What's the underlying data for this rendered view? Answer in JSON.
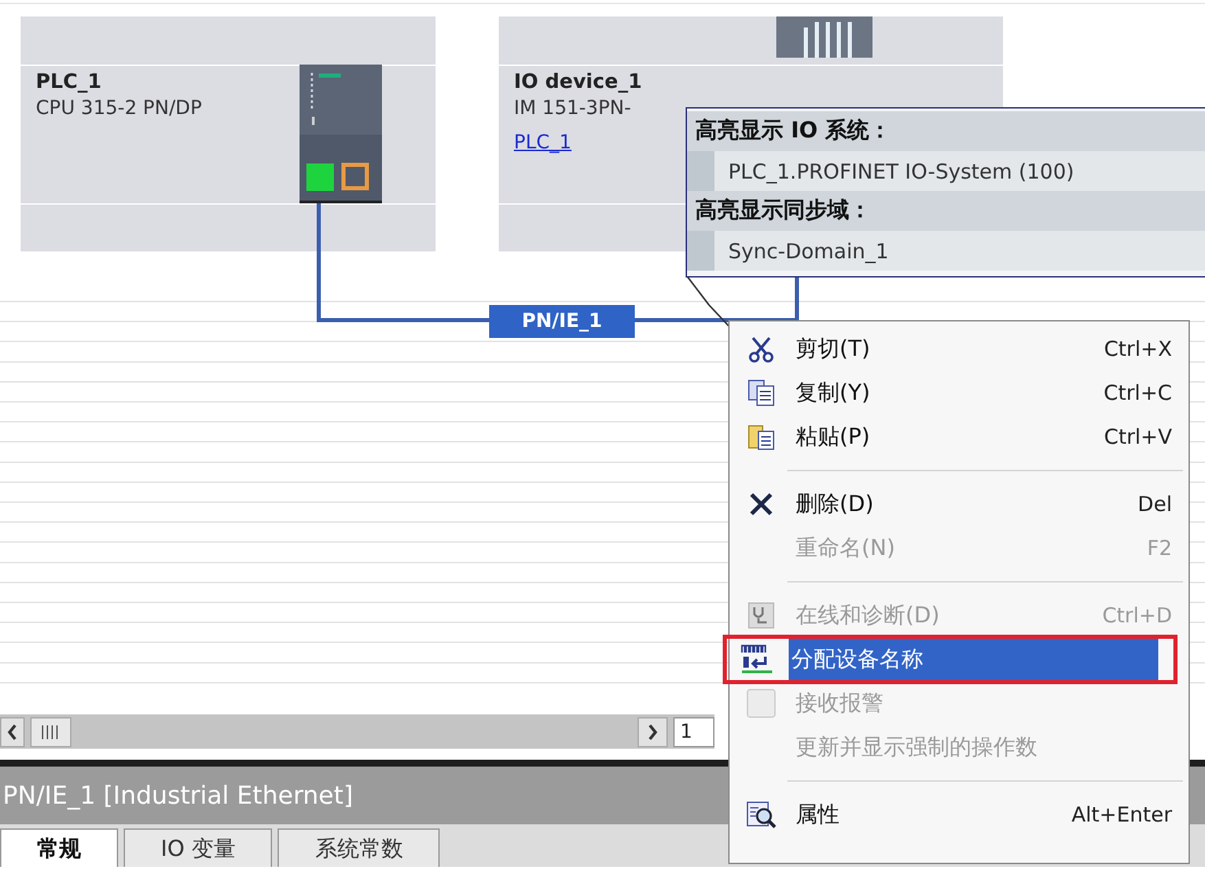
{
  "devices": [
    {
      "name": "PLC_1",
      "model": "CPU 315-2 PN/DP",
      "kind": "cpu"
    },
    {
      "name": "IO device_1",
      "model": "IM 151-3PN-",
      "link": "PLC_1",
      "kind": "io"
    }
  ],
  "network": {
    "label": "PN/IE_1"
  },
  "tooltip": {
    "sections": [
      {
        "heading": "高亮显示 IO 系统：",
        "item": "PLC_1.PROFINET IO-System (100)"
      },
      {
        "heading": "高亮显示同步域：",
        "item": "Sync-Domain_1"
      }
    ]
  },
  "context_menu": [
    {
      "kind": "item",
      "label": "剪切(T)",
      "shortcut": "Ctrl+X",
      "disabled": false,
      "selected": false,
      "outlined": false
    },
    {
      "kind": "item",
      "label": "复制(Y)",
      "shortcut": "Ctrl+C",
      "disabled": false,
      "selected": false,
      "outlined": false
    },
    {
      "kind": "item",
      "label": "粘贴(P)",
      "shortcut": "Ctrl+V",
      "disabled": false,
      "selected": false,
      "outlined": false
    },
    {
      "kind": "separator"
    },
    {
      "kind": "item",
      "label": "删除(D)",
      "shortcut": "Del",
      "disabled": false,
      "selected": false,
      "outlined": false
    },
    {
      "kind": "item",
      "label": "重命名(N)",
      "shortcut": "F2",
      "disabled": true,
      "selected": false,
      "outlined": false
    },
    {
      "kind": "separator"
    },
    {
      "kind": "item",
      "label": "在线和诊断(D)",
      "shortcut": "Ctrl+D",
      "disabled": true,
      "selected": false,
      "outlined": false
    },
    {
      "kind": "item",
      "label": "分配设备名称",
      "disabled": false,
      "selected": true,
      "outlined": true
    },
    {
      "kind": "item",
      "label": "接收报警",
      "disabled": true,
      "selected": false,
      "outlined": false
    },
    {
      "kind": "item",
      "label": "更新并显示强制的操作数",
      "disabled": true,
      "selected": false,
      "outlined": false
    },
    {
      "kind": "separator"
    },
    {
      "kind": "item",
      "label": "属性",
      "shortcut": "Alt+Enter",
      "disabled": false,
      "selected": false,
      "outlined": false
    }
  ],
  "zoom_field": {
    "value": "1"
  },
  "properties_panel": {
    "title": "PN/IE_1 [Industrial Ethernet]",
    "tabs": [
      {
        "label": "常规",
        "selected": true
      },
      {
        "label": "IO 变量",
        "selected": false
      },
      {
        "label": "系统常数",
        "selected": false
      }
    ]
  }
}
